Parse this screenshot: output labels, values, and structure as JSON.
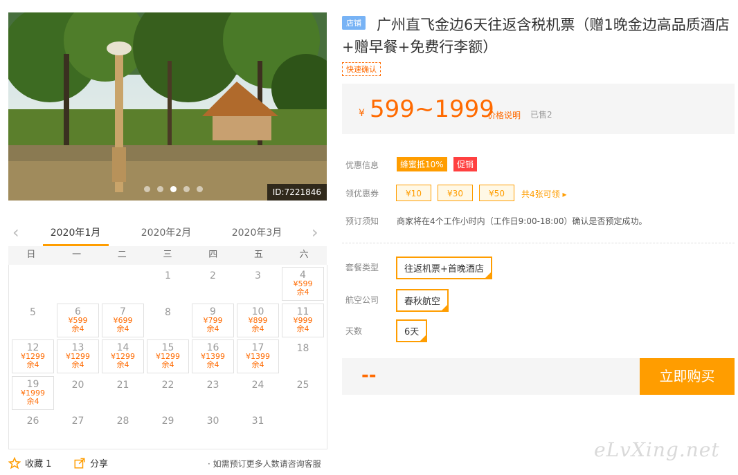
{
  "photo": {
    "id_label": "ID:7221846",
    "slides": 5,
    "active_slide": 2
  },
  "calendar": {
    "months": [
      "2020年1月",
      "2020年2月",
      "2020年3月"
    ],
    "active_month": 0,
    "weekdays": [
      "日",
      "一",
      "二",
      "三",
      "四",
      "五",
      "六"
    ],
    "days": [
      {
        "d": "1"
      },
      {
        "d": "2"
      },
      {
        "d": "3"
      },
      {
        "d": "4",
        "price": "¥599",
        "remain": "余4"
      },
      {
        "d": "5"
      },
      {
        "d": "6",
        "price": "¥599",
        "remain": "余4"
      },
      {
        "d": "7",
        "price": "¥699",
        "remain": "余4"
      },
      {
        "d": "8"
      },
      {
        "d": "9",
        "price": "¥799",
        "remain": "余4"
      },
      {
        "d": "10",
        "price": "¥899",
        "remain": "余4"
      },
      {
        "d": "11",
        "price": "¥999",
        "remain": "余4"
      },
      {
        "d": "12",
        "price": "¥1299",
        "remain": "余4"
      },
      {
        "d": "13",
        "price": "¥1299",
        "remain": "余4"
      },
      {
        "d": "14",
        "price": "¥1299",
        "remain": "余4"
      },
      {
        "d": "15",
        "price": "¥1299",
        "remain": "余4"
      },
      {
        "d": "16",
        "price": "¥1399",
        "remain": "余4"
      },
      {
        "d": "17",
        "price": "¥1399",
        "remain": "余4"
      },
      {
        "d": "18"
      },
      {
        "d": "19",
        "price": "¥1999",
        "remain": "余4"
      },
      {
        "d": "20"
      },
      {
        "d": "21"
      },
      {
        "d": "22"
      },
      {
        "d": "23"
      },
      {
        "d": "24"
      },
      {
        "d": "25"
      },
      {
        "d": "26"
      },
      {
        "d": "27"
      },
      {
        "d": "28"
      },
      {
        "d": "29"
      },
      {
        "d": "30"
      },
      {
        "d": "31"
      }
    ],
    "first_weekday": 3
  },
  "actions": {
    "favorite": "收藏 1",
    "share": "分享",
    "note": "· 如需预订更多人数请咨询客服"
  },
  "product": {
    "shop_badge": "店铺",
    "title": "广州直飞金边6天往返含税机票（赠1晚金边高品质酒店+赠早餐+免费行李额）",
    "fast_confirm": "快速确认",
    "currency": "¥",
    "price_range": "599~1999",
    "price_desc": "价格说明",
    "sold": "已售2"
  },
  "promo": {
    "label": "优惠信息",
    "tags": [
      "蜂蜜抵10%",
      "促销"
    ]
  },
  "coupons": {
    "label": "领优惠券",
    "items": [
      "¥10",
      "¥30",
      "¥50"
    ],
    "more": "共4张可领 ▸"
  },
  "booking": {
    "label": "预订须知",
    "text": "商家将在4个工作小时内（工作日9:00-18:00）确认是否预定成功。"
  },
  "options": [
    {
      "label": "套餐类型",
      "value": "往返机票+首晚酒店"
    },
    {
      "label": "航空公司",
      "value": "春秋航空"
    },
    {
      "label": "天数",
      "value": "6天"
    }
  ],
  "buy": {
    "total": "--",
    "button": "立即购买"
  },
  "watermark": "eLvXing.net"
}
